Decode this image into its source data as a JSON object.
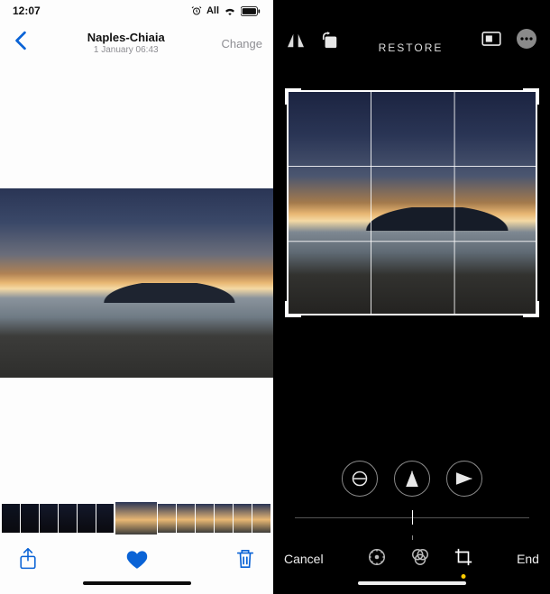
{
  "status": {
    "time": "12:07",
    "network_label": "All"
  },
  "left": {
    "title": "Naples-Chiaia",
    "timestamp": "1 January 06:43",
    "change_label": "Change"
  },
  "right": {
    "restore_label": "RESTORE",
    "cancel_label": "Cancel",
    "done_label": "End"
  },
  "icons": {
    "back": "back-chevron",
    "wifi": "wifi-icon",
    "battery": "battery-icon",
    "alarm": "alarm-icon",
    "share": "share-icon",
    "heart": "heart-icon",
    "trash": "trash-icon",
    "flip_h": "flip-horizontal-icon",
    "rotate": "rotate-icon",
    "aspect": "aspect-ratio-icon",
    "more": "more-icon",
    "straighten": "straighten-icon",
    "flip_tool": "flip-vertical-icon",
    "perspective": "perspective-icon",
    "adjust": "adjust-icon",
    "filters": "filters-icon",
    "crop": "crop-icon"
  }
}
